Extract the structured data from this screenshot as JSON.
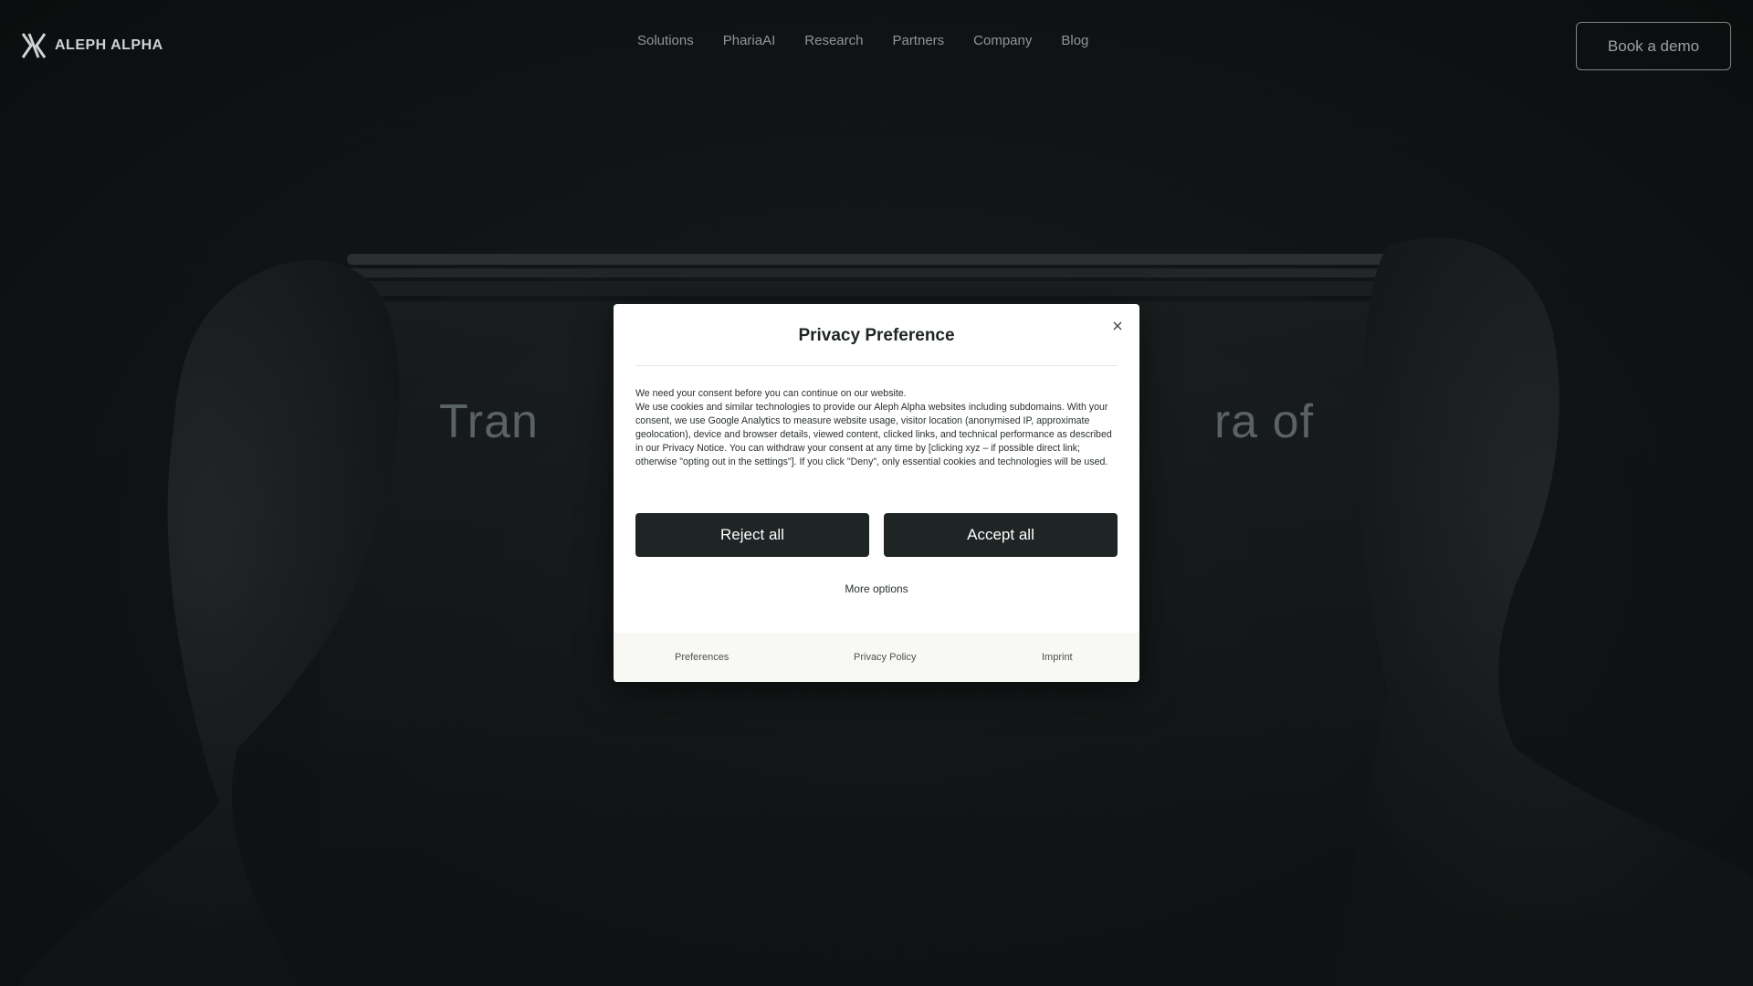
{
  "header": {
    "logo_text": "ALEPH ALPHA",
    "logo_icon": "aleph-alpha-logo-icon",
    "nav": [
      {
        "label": "Solutions"
      },
      {
        "label": "PhariaAI"
      },
      {
        "label": "Research"
      },
      {
        "label": "Partners"
      },
      {
        "label": "Company"
      },
      {
        "label": "Blog"
      }
    ],
    "cta_label": "Book a demo"
  },
  "hero": {
    "title_left": "Tran",
    "title_right": "ra of"
  },
  "modal": {
    "title": "Privacy Preference",
    "close_icon": "close-icon",
    "body": [
      "We need your consent before you can continue on our website.",
      "We use cookies and similar technologies to provide our Aleph Alpha websites including subdomains. With your consent, we use Google Analytics to measure website usage, visitor location (anonymised IP, approximate geolocation), device and browser details, viewed content, clicked links, and technical performance as described in our Privacy Notice. You can withdraw your consent at any time by [clicking xyz – if possible direct link; otherwise \"opting out in the settings\"]. If you click \"Deny\", only essential cookies and technologies will be used."
    ],
    "reject_label": "Reject all",
    "accept_label": "Accept all",
    "more_options_label": "More options",
    "footer": {
      "preferences": "Preferences",
      "privacy_policy": "Privacy Policy",
      "imprint": "Imprint"
    }
  },
  "colors": {
    "page_background": "#0d1111",
    "modal_background": "#ffffff",
    "button_dark": "#1f2424",
    "footer_background": "#f8f8f4"
  }
}
